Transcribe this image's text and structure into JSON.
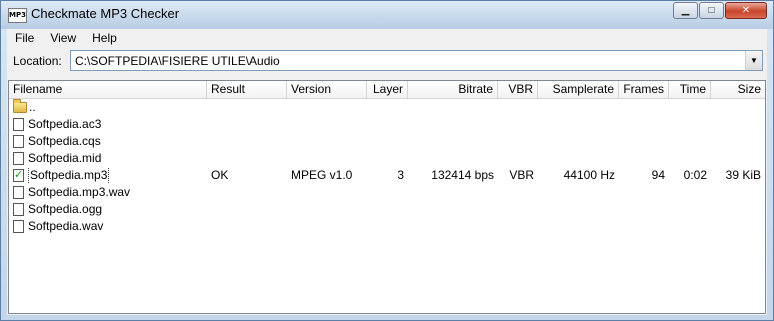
{
  "window": {
    "title": "Checkmate MP3 Checker",
    "app_icon_text": "MP3",
    "minimize_glyph": "▁",
    "maximize_glyph": "□",
    "close_glyph": "✕"
  },
  "menu": [
    "File",
    "View",
    "Help"
  ],
  "location": {
    "label": "Location:",
    "value": "C:\\SOFTPEDIA\\FISIERE UTILE\\Audio",
    "dropdown_glyph": "▼"
  },
  "columns": [
    "Filename",
    "Result",
    "Version",
    "Layer",
    "Bitrate",
    "VBR",
    "Samplerate",
    "Frames",
    "Time",
    "Size"
  ],
  "rows": [
    {
      "icon": "folder-icon",
      "filename": "..",
      "result": "",
      "version": "",
      "layer": "",
      "bitrate": "",
      "vbr": "",
      "samplerate": "",
      "frames": "",
      "time": "",
      "size": ""
    },
    {
      "icon": "file-icon",
      "filename": "Softpedia.ac3",
      "result": "",
      "version": "",
      "layer": "",
      "bitrate": "",
      "vbr": "",
      "samplerate": "",
      "frames": "",
      "time": "",
      "size": ""
    },
    {
      "icon": "file-icon",
      "filename": "Softpedia.cqs",
      "result": "",
      "version": "",
      "layer": "",
      "bitrate": "",
      "vbr": "",
      "samplerate": "",
      "frames": "",
      "time": "",
      "size": ""
    },
    {
      "icon": "file-icon",
      "filename": "Softpedia.mid",
      "result": "",
      "version": "",
      "layer": "",
      "bitrate": "",
      "vbr": "",
      "samplerate": "",
      "frames": "",
      "time": "",
      "size": ""
    },
    {
      "icon": "check-icon",
      "filename": "Softpedia.mp3",
      "result": "OK",
      "version": "MPEG v1.0",
      "layer": "3",
      "bitrate": "132414 bps",
      "vbr": "VBR",
      "samplerate": "44100 Hz",
      "frames": "94",
      "time": "0:02",
      "size": "39 KiB",
      "selected": true
    },
    {
      "icon": "file-icon",
      "filename": "Softpedia.mp3.wav",
      "result": "",
      "version": "",
      "layer": "",
      "bitrate": "",
      "vbr": "",
      "samplerate": "",
      "frames": "",
      "time": "",
      "size": ""
    },
    {
      "icon": "file-icon",
      "filename": "Softpedia.ogg",
      "result": "",
      "version": "",
      "layer": "",
      "bitrate": "",
      "vbr": "",
      "samplerate": "",
      "frames": "",
      "time": "",
      "size": ""
    },
    {
      "icon": "file-icon",
      "filename": "Softpedia.wav",
      "result": "",
      "version": "",
      "layer": "",
      "bitrate": "",
      "vbr": "",
      "samplerate": "",
      "frames": "",
      "time": "",
      "size": ""
    }
  ],
  "check_glyph": "✓"
}
